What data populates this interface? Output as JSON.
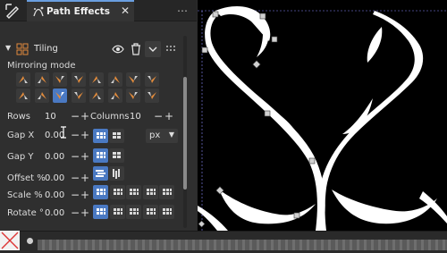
{
  "tabs": [
    {
      "label": "Path Effects"
    }
  ],
  "effect": {
    "name": "Tiling"
  },
  "mirroring": {
    "label": "Mirroring mode",
    "selected_index": 10,
    "count": 16
  },
  "rows": {
    "label": "Rows",
    "value": "10"
  },
  "columns": {
    "label": "Columns",
    "value": "10"
  },
  "gap_x": {
    "label": "Gap X",
    "value": "0.00"
  },
  "gap_y": {
    "label": "Gap Y",
    "value": "0.00"
  },
  "offset": {
    "label": "Offset %",
    "value": "0.00"
  },
  "scale": {
    "label": "Scale %",
    "value": "0.00"
  },
  "rotate": {
    "label": "Rotate °",
    "value": "0.00"
  },
  "unit": {
    "value": "px"
  },
  "symbols": {
    "close": "✕",
    "plus": "+",
    "minus": "−",
    "arrow_down": "▼",
    "menu": "⋯"
  },
  "colors": {
    "accent": "#4a79c2",
    "canvas": "#000000",
    "panel": "#2f2f2f"
  }
}
